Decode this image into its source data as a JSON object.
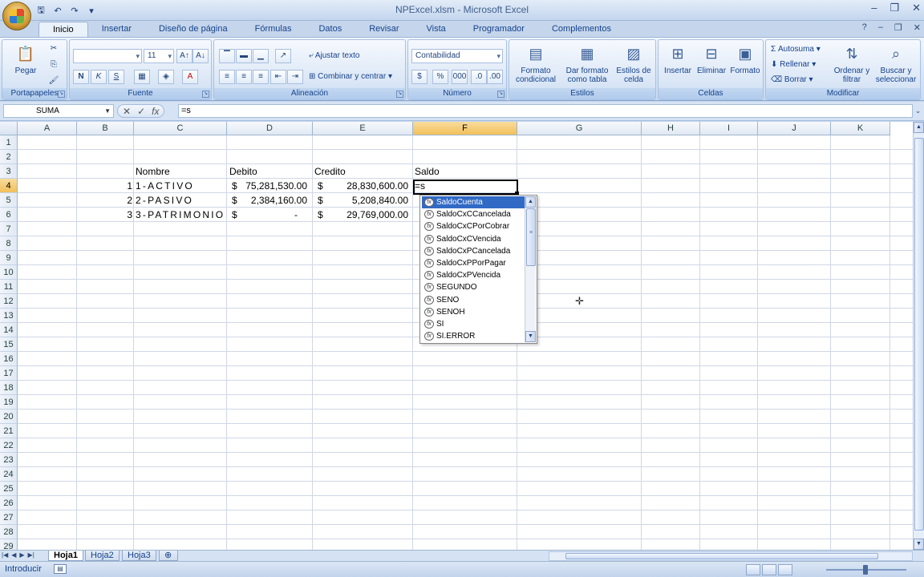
{
  "app": {
    "title": "NPExcel.xlsm - Microsoft Excel",
    "qat": [
      "save-icon",
      "undo-icon",
      "redo-icon",
      "customize-icon"
    ]
  },
  "tabs": [
    "Inicio",
    "Insertar",
    "Diseño de página",
    "Fórmulas",
    "Datos",
    "Revisar",
    "Vista",
    "Programador",
    "Complementos"
  ],
  "active_tab": "Inicio",
  "ribbon": {
    "portapapeles": {
      "label": "Portapapeles",
      "pegar": "Pegar"
    },
    "fuente": {
      "label": "Fuente",
      "font_name": "",
      "font_size": "11",
      "bold": "N",
      "italic": "K",
      "underline": "S"
    },
    "alineacion": {
      "label": "Alineación",
      "ajustar": "Ajustar texto",
      "combinar": "Combinar y centrar"
    },
    "numero": {
      "label": "Número",
      "format": "Contabilidad",
      "currency": "$",
      "percent": "%",
      "thousands": "000"
    },
    "estilos": {
      "label": "Estilos",
      "formato_condicional": "Formato condicional",
      "dar_formato": "Dar formato como tabla",
      "estilos_celda": "Estilos de celda"
    },
    "celdas": {
      "label": "Celdas",
      "insertar": "Insertar",
      "eliminar": "Eliminar",
      "formato": "Formato"
    },
    "modificar": {
      "label": "Modificar",
      "autosuma": "Autosuma",
      "rellenar": "Rellenar",
      "borrar": "Borrar",
      "ordenar": "Ordenar y filtrar",
      "buscar": "Buscar y seleccionar"
    }
  },
  "formula_bar": {
    "name_box": "SUMA",
    "formula": "=s"
  },
  "columns": [
    "A",
    "B",
    "C",
    "D",
    "E",
    "F",
    "G",
    "H",
    "I",
    "J",
    "K"
  ],
  "selected_column": "F",
  "rows": [
    "1",
    "2",
    "3",
    "4",
    "5",
    "6",
    "7",
    "8",
    "9",
    "10",
    "11",
    "12",
    "13",
    "14",
    "15",
    "16",
    "17",
    "18",
    "19",
    "20",
    "21",
    "22",
    "23",
    "24",
    "25",
    "26",
    "27",
    "28",
    "29"
  ],
  "selected_row": "4",
  "sheet": {
    "headers": {
      "nombre": "Nombre",
      "debito": "Debito",
      "credito": "Credito",
      "saldo": "Saldo"
    },
    "data": [
      {
        "num": "1",
        "nombre": "1-ACTIVO",
        "cur_d": "$",
        "debito": "75,281,530.00",
        "cur_c": "$",
        "credito": "28,830,600.00"
      },
      {
        "num": "2",
        "nombre": "2-PASIVO",
        "cur_d": "$",
        "debito": "2,384,160.00",
        "cur_c": "$",
        "credito": "5,208,840.00"
      },
      {
        "num": "3",
        "nombre": "3-PATRIMONIO",
        "cur_d": "$",
        "debito": "-",
        "cur_c": "$",
        "credito": "29,769,000.00"
      }
    ],
    "active_cell_text": "=s"
  },
  "autocomplete": [
    "SaldoCuenta",
    "SaldoCxCCancelada",
    "SaldoCxCPorCobrar",
    "SaldoCxCVencida",
    "SaldoCxPCancelada",
    "SaldoCxPPorPagar",
    "SaldoCxPVencida",
    "SEGUNDO",
    "SENO",
    "SENOH",
    "SI",
    "SI.ERROR"
  ],
  "sheet_tabs": [
    "Hoja1",
    "Hoja2",
    "Hoja3"
  ],
  "active_sheet": "Hoja1",
  "status": {
    "mode": "Introducir"
  }
}
